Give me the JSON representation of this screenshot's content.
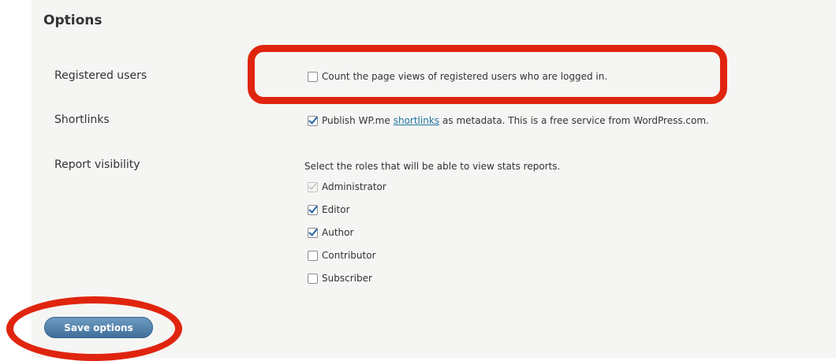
{
  "section": {
    "title": "Options"
  },
  "registered_users": {
    "label": "Registered users",
    "option_text": "Count the page views of registered users who are logged in.",
    "checked": false
  },
  "shortlinks": {
    "label": "Shortlinks",
    "text_before": "Publish WP.me",
    "link_text": "shortlinks",
    "text_after": "as metadata. This is a free service from WordPress.com.",
    "checked": true
  },
  "report_visibility": {
    "label": "Report visibility",
    "help": "Select the roles that will be able to view stats reports.",
    "roles": [
      {
        "label": "Administrator",
        "checked": true,
        "disabled": true
      },
      {
        "label": "Editor",
        "checked": true,
        "disabled": false
      },
      {
        "label": "Author",
        "checked": true,
        "disabled": false
      },
      {
        "label": "Contributor",
        "checked": false,
        "disabled": false
      },
      {
        "label": "Subscriber",
        "checked": false,
        "disabled": false
      }
    ]
  },
  "actions": {
    "save_label": "Save options"
  },
  "colors": {
    "highlight": "#e0250f",
    "button": "#4a7aa5",
    "link": "#21759b",
    "panel_bg": "#f5f5f3"
  }
}
